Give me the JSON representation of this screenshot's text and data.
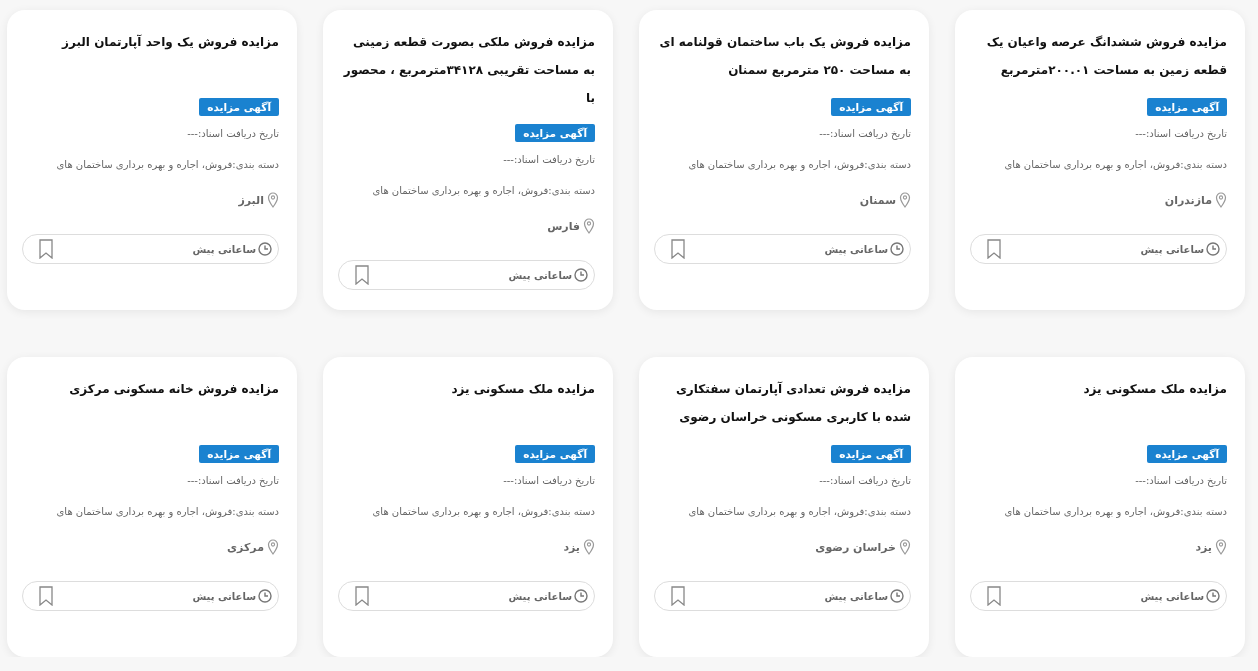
{
  "cards": [
    {
      "title": "مزایده فروش ششدانگ عرصه واعیان یک قطعه زمین به مساحت ۲۰۰.۰۱مترمربع",
      "badge": "آگهی مزایده",
      "date": "تاریخ دریافت اسناد:---",
      "category": "دسته بندی:فروش، اجاره و بهره برداری ساختمان های",
      "location": "مازندران",
      "time": "ساعاتی پیش"
    },
    {
      "title": "مزایده فروش یک باب ساختمان قولنامه ای به مساحت ۲۵۰ مترمربع سمنان",
      "badge": "آگهی مزایده",
      "date": "تاریخ دریافت اسناد:---",
      "category": "دسته بندی:فروش، اجاره و بهره برداری ساختمان های",
      "location": "سمنان",
      "time": "ساعاتی پیش"
    },
    {
      "title": "مزایده فروش ملکی بصورت قطعه زمینی به مساحت تقریبی ۳۴۱۲۸مترمربع ، محصور با",
      "badge": "آگهی مزایده",
      "date": "تاریخ دریافت اسناد:---",
      "category": "دسته بندی:فروش، اجاره و بهره برداری ساختمان های",
      "location": "فارس",
      "time": "ساعاتی پیش"
    },
    {
      "title": "مزایده فروش یک واحد آپارتمان البرز",
      "badge": "آگهی مزایده",
      "date": "تاریخ دریافت اسناد:---",
      "category": "دسته بندی:فروش، اجاره و بهره برداری ساختمان های",
      "location": "البرز",
      "time": "ساعاتی پیش"
    },
    {
      "title": "مزایده ملک مسکونی یزد",
      "badge": "آگهی مزایده",
      "date": "تاریخ دریافت اسناد:---",
      "category": "دسته بندی:فروش، اجاره و بهره برداری ساختمان های",
      "location": "یزد",
      "time": "ساعاتی پیش"
    },
    {
      "title": "مزایده فروش تعدادی آپارتمان سفتکاری شده با کاربری مسکونی خراسان رضوی",
      "badge": "آگهی مزایده",
      "date": "تاریخ دریافت اسناد:---",
      "category": "دسته بندی:فروش، اجاره و بهره برداری ساختمان های",
      "location": "خراسان رضوی",
      "time": "ساعاتی پیش"
    },
    {
      "title": "مزایده ملک مسکونی یزد",
      "badge": "آگهی مزایده",
      "date": "تاریخ دریافت اسناد:---",
      "category": "دسته بندی:فروش، اجاره و بهره برداری ساختمان های",
      "location": "یزد",
      "time": "ساعاتی پیش"
    },
    {
      "title": "مزایده فروش خانه مسکونی مرکزی",
      "badge": "آگهی مزایده",
      "date": "تاریخ دریافت اسناد:---",
      "category": "دسته بندی:فروش، اجاره و بهره برداری ساختمان های",
      "location": "مرکزی",
      "time": "ساعاتی پیش"
    }
  ]
}
